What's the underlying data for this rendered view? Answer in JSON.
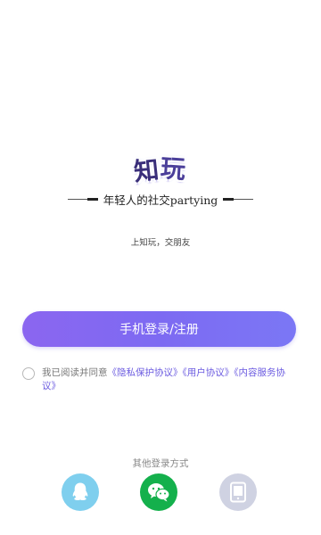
{
  "logo": {
    "text_char1": "知",
    "text_char2": "玩"
  },
  "slogan": {
    "text": "年轻人的社交partying"
  },
  "tagline": {
    "text": "上知玩，交朋友"
  },
  "login_button": {
    "label": "手机登录/注册",
    "colors": [
      "#8b66f0",
      "#7b77f5"
    ]
  },
  "agreement": {
    "prefix": "我已阅读并同意",
    "privacy_link": "《隐私保护协议》",
    "user_link": "《用户协议》",
    "service_link": "《内容服务协议》",
    "link_color": "#6b5be0",
    "checked": false
  },
  "other_login": {
    "label": "其他登录方式",
    "options": [
      {
        "icon": "qq-icon",
        "color": "#7fcfee"
      },
      {
        "icon": "wechat-icon",
        "color": "#14b04c"
      },
      {
        "icon": "tablet-icon",
        "color": "#cfd2e2"
      }
    ]
  }
}
